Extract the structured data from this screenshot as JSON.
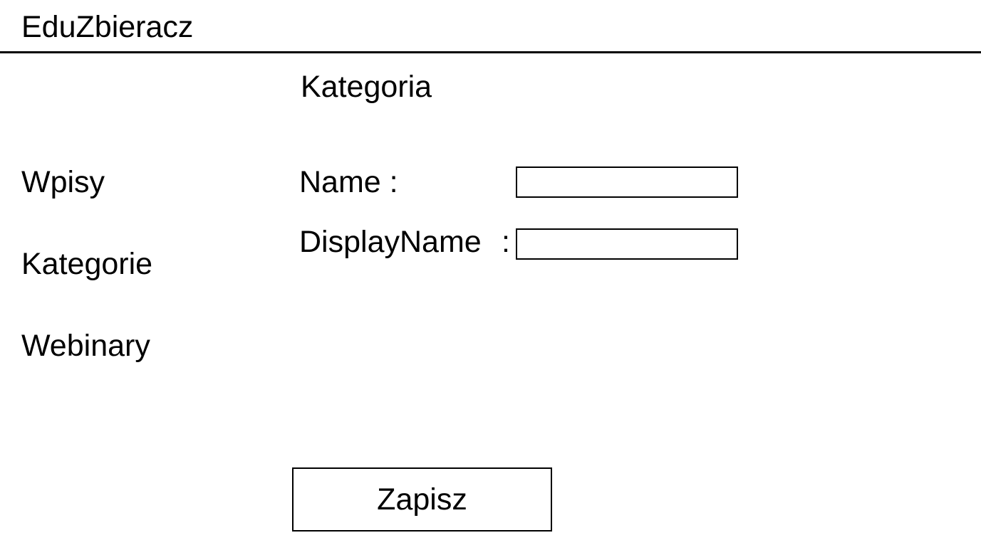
{
  "header": {
    "app_title": "EduZbieracz"
  },
  "sidebar": {
    "items": [
      {
        "label": "Wpisy"
      },
      {
        "label": "Kategorie"
      },
      {
        "label": "Webinary"
      }
    ]
  },
  "main": {
    "title": "Kategoria",
    "form": {
      "name_label": "Name :",
      "name_value": "",
      "display_name_label": "DisplayName",
      "display_name_colon": ":",
      "display_name_value": "",
      "save_label": "Zapisz"
    }
  },
  "colors": {
    "background": "#ffffff",
    "foreground": "#000000"
  }
}
